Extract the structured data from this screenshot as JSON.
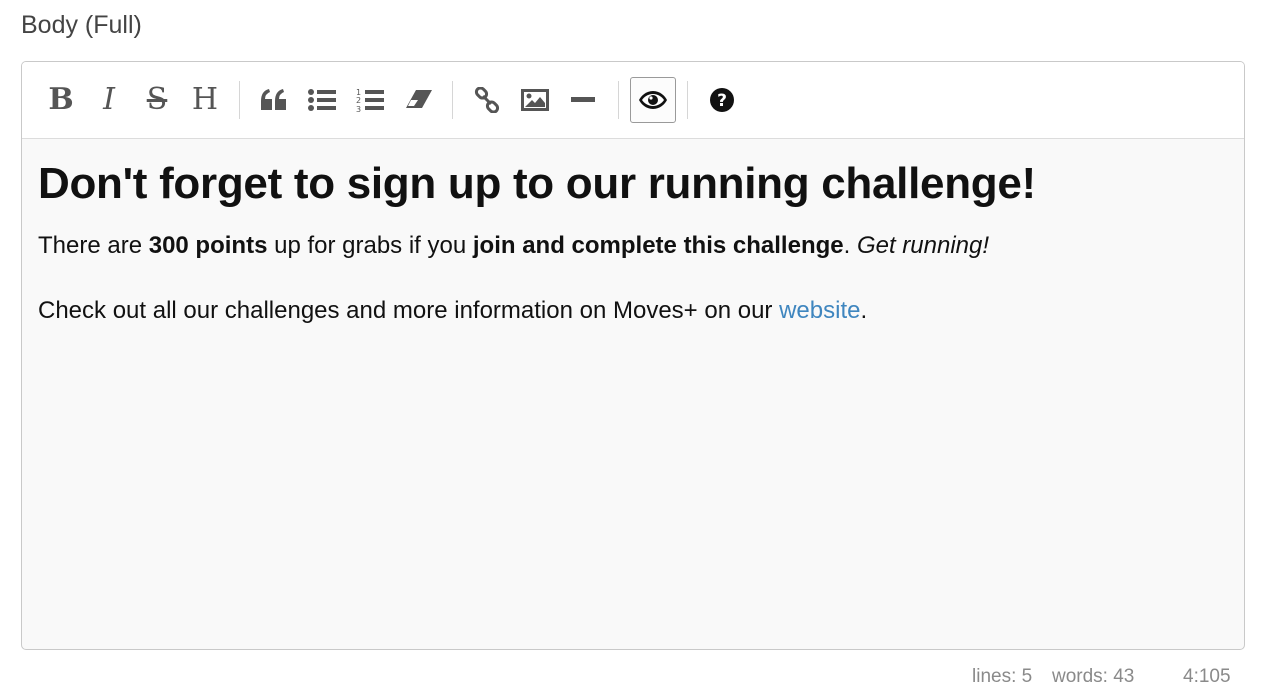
{
  "field": {
    "label": "Body (Full)"
  },
  "toolbar": {
    "buttons": [
      {
        "name": "bold",
        "icon": "bold-icon",
        "glyph": "B"
      },
      {
        "name": "italic",
        "icon": "italic-icon",
        "glyph": "I"
      },
      {
        "name": "strikethrough",
        "icon": "strikethrough-icon",
        "glyph": "S"
      },
      {
        "name": "heading",
        "icon": "heading-icon",
        "glyph": "H"
      },
      {
        "name": "quote",
        "icon": "quote-icon"
      },
      {
        "name": "unordered-list",
        "icon": "bulleted-list-icon"
      },
      {
        "name": "ordered-list",
        "icon": "numbered-list-icon"
      },
      {
        "name": "clean-block",
        "icon": "eraser-icon"
      },
      {
        "name": "link",
        "icon": "link-icon"
      },
      {
        "name": "image",
        "icon": "image-icon"
      },
      {
        "name": "horizontal-rule",
        "icon": "minus-icon"
      },
      {
        "name": "preview",
        "icon": "eye-icon",
        "active": true
      },
      {
        "name": "guide",
        "icon": "question-circle-icon"
      }
    ]
  },
  "content": {
    "heading": "Don't forget to sign up to our running challenge!",
    "p1": {
      "t1": "There are ",
      "b1": "300 points",
      "t2": " up for grabs if you ",
      "b2": "join and complete this challenge",
      "t3": ". ",
      "i1": "Get running!"
    },
    "p2": {
      "t1": "Check out all our challenges and more information on Moves+ on our ",
      "link": "website",
      "t2": "."
    }
  },
  "statusbar": {
    "lines": "lines: 5",
    "words": "words: 43",
    "cursor": "4:105"
  },
  "colors": {
    "link": "#3f86bf",
    "icon": "#555555",
    "editor_bg": "#f9f9f9"
  }
}
